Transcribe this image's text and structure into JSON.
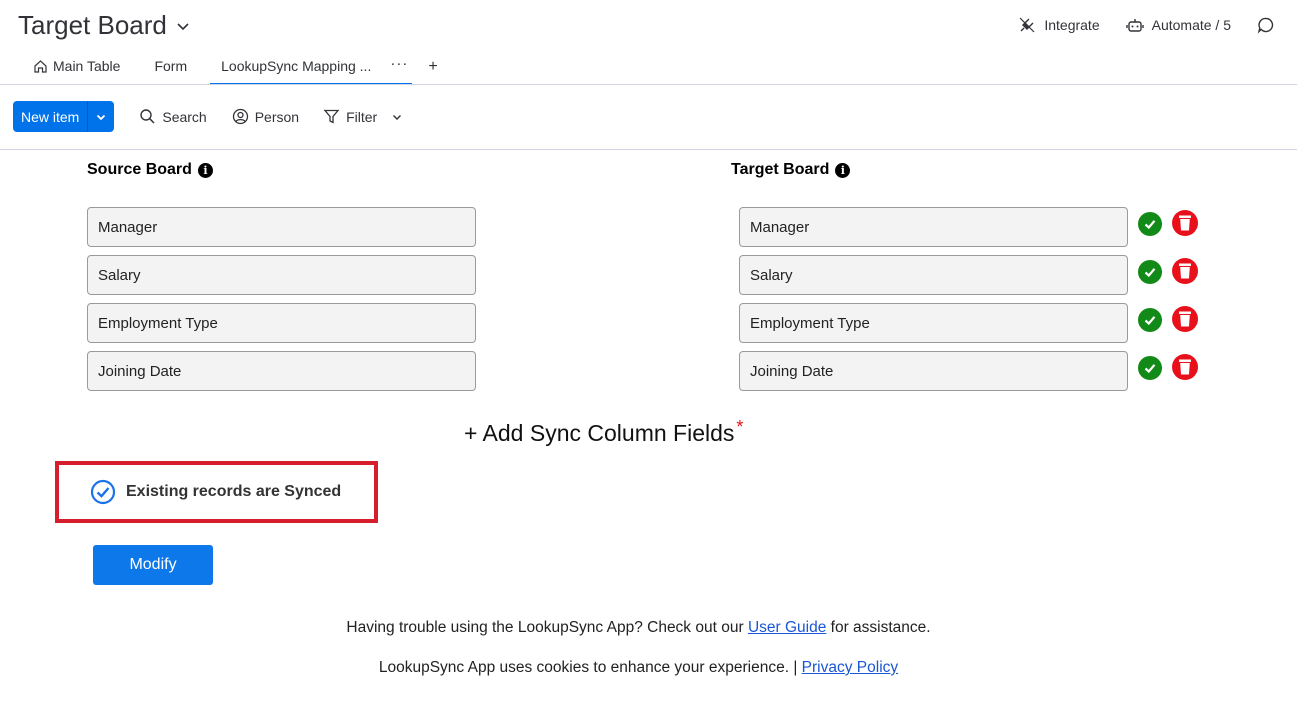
{
  "header": {
    "board_title": "Target Board",
    "integrate_label": "Integrate",
    "automate_label": "Automate / 5"
  },
  "tabs": [
    {
      "label": "Main Table",
      "icon": "home-icon"
    },
    {
      "label": "Form"
    },
    {
      "label": "LookupSync Mapping ...",
      "active": true
    }
  ],
  "tabs_more": "···",
  "tabs_add": "+",
  "toolbar": {
    "new_item_label": "New item",
    "search_label": "Search",
    "person_label": "Person",
    "filter_label": "Filter"
  },
  "mapping": {
    "source_heading": "Source Board",
    "target_heading": "Target Board",
    "info_glyph": "i",
    "rows": [
      {
        "source": "Manager",
        "target": "Manager"
      },
      {
        "source": "Salary",
        "target": "Salary"
      },
      {
        "source": "Employment Type",
        "target": "Employment Type"
      },
      {
        "source": "Joining Date",
        "target": "Joining Date"
      }
    ],
    "add_sync_label": "+ Add Sync Column Fields",
    "required_mark": "*"
  },
  "sync_status": {
    "text": "Existing records are Synced"
  },
  "modify_label": "Modify",
  "footer": {
    "help_prefix": "Having trouble using the LookupSync App? Check out our ",
    "help_link": "User Guide",
    "help_suffix": " for assistance.",
    "cookie_prefix": "LookupSync App uses cookies to enhance your experience. | ",
    "cookie_link": "Privacy Policy"
  },
  "colors": {
    "accent": "#0073ea",
    "success": "#128a17",
    "danger": "#e8111b",
    "highlight_border": "#d51f2c"
  }
}
